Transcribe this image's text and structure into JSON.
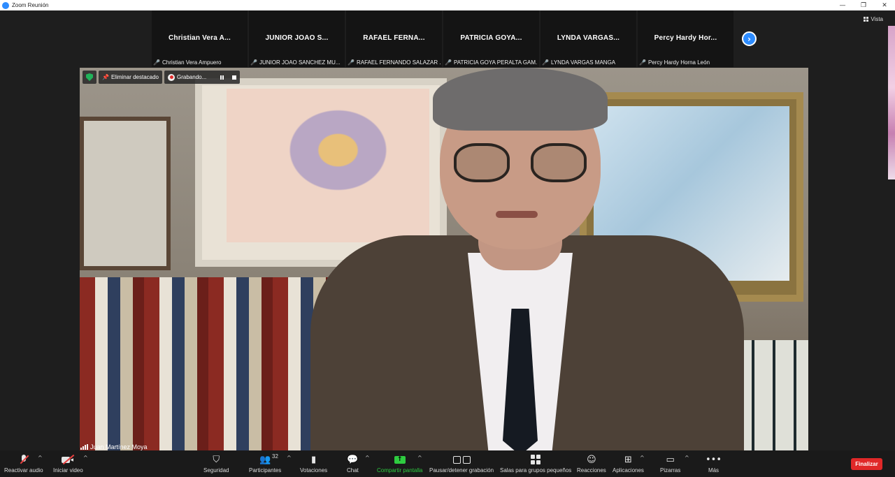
{
  "window": {
    "title": "Zoom Reunión",
    "controls": [
      "—",
      "❐",
      "✕"
    ]
  },
  "view_button": {
    "label": "Vista"
  },
  "filmstrip": [
    {
      "name": "Christian Vera A...",
      "label": "Christian Vera Ampuero"
    },
    {
      "name": "JUNIOR JOAO S...",
      "label": "JUNIOR JOAO SANCHEZ MU..."
    },
    {
      "name": "RAFAEL FERNA...",
      "label": "RAFAEL FERNANDO SALAZAR ..."
    },
    {
      "name": "PATRICIA GOYA...",
      "label": "PATRICIA GOYA PERALTA GAM..."
    },
    {
      "name": "LYNDA VARGAS...",
      "label": "LYNDA VARGAS MANGA"
    },
    {
      "name": "Percy Hardy Hor...",
      "label": "Percy Hardy Horna León"
    }
  ],
  "video_toolbar": {
    "unpin_label": "Eliminar destacado",
    "recording_label": "Grabando..."
  },
  "speaker": {
    "name": "Juan Martínez Moya"
  },
  "toolbar": {
    "audio_label": "Reactivar audio",
    "video_label": "Iniciar video",
    "security_label": "Seguridad",
    "participants_label": "Participantes",
    "participants_count": "32",
    "polls_label": "Votaciones",
    "chat_label": "Chat",
    "share_label": "Compartir pantalla",
    "record_label": "Pausar/detener grabación",
    "breakout_label": "Salas para grupos pequeños",
    "reactions_label": "Reacciones",
    "apps_label": "Aplicaciones",
    "whiteboards_label": "Pizarras",
    "more_label": "Más",
    "end_label": "Finalizar"
  },
  "colors": {
    "accent": "#2d8cff",
    "share_green": "#2ecc40",
    "end_red": "#e02828",
    "muted_red": "#e84040"
  }
}
